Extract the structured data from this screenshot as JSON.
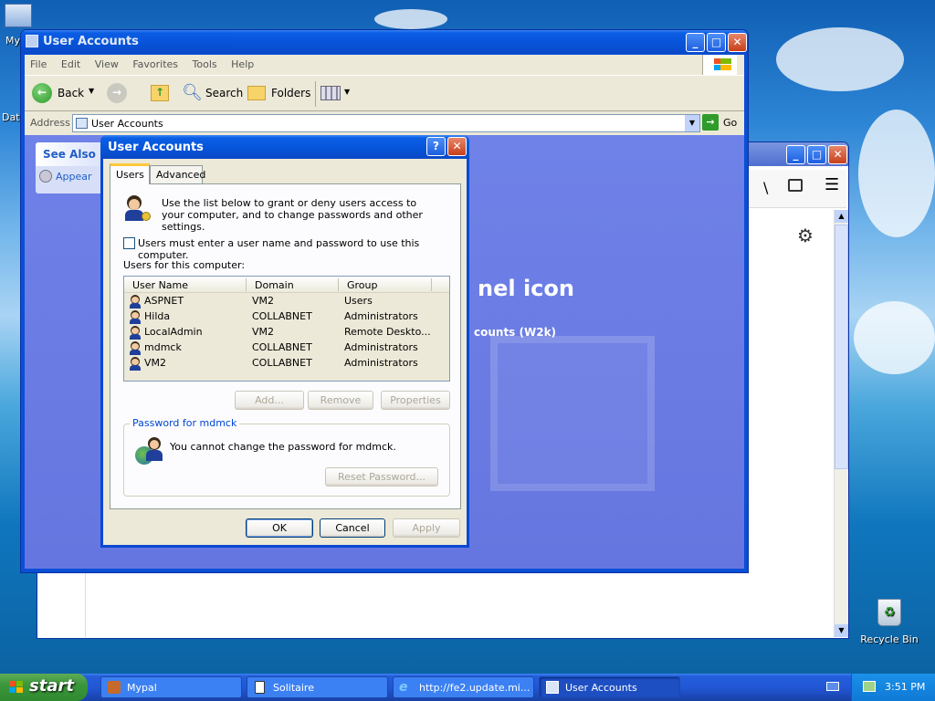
{
  "desktop": {
    "icons": [
      {
        "label": "My"
      },
      {
        "label": "Dat"
      },
      {
        "label": "Recycle Bin"
      }
    ]
  },
  "explorer": {
    "title": "User Accounts",
    "menu": [
      "File",
      "Edit",
      "View",
      "Favorites",
      "Tools",
      "Help"
    ],
    "toolbar": {
      "back": "Back",
      "search": "Search",
      "folders": "Folders"
    },
    "address_label": "Address",
    "address_value": "User Accounts",
    "go": "Go",
    "see_also": {
      "title": "See Also",
      "item": "Appear"
    },
    "bg_text_1": "nel icon",
    "bg_text_2": "counts (W2k)"
  },
  "dialog": {
    "title": "User Accounts",
    "help_btn": "?",
    "close_btn": "✕",
    "tabs": [
      "Users",
      "Advanced"
    ],
    "intro": "Use the list below to grant or deny users access to your computer, and to change passwords and other settings.",
    "checkbox_label": "Users must enter a user name and password to use this computer.",
    "checkbox_checked": false,
    "list_label": "Users for this computer:",
    "columns": [
      "User Name",
      "Domain",
      "Group"
    ],
    "users": [
      {
        "name": "ASPNET",
        "domain": "VM2",
        "group": "Users"
      },
      {
        "name": "Hilda",
        "domain": "COLLABNET",
        "group": "Administrators"
      },
      {
        "name": "LocalAdmin",
        "domain": "VM2",
        "group": "Remote Deskto..."
      },
      {
        "name": "mdmck",
        "domain": "COLLABNET",
        "group": "Administrators"
      },
      {
        "name": "VM2",
        "domain": "COLLABNET",
        "group": "Administrators"
      }
    ],
    "buttons": {
      "add": "Add...",
      "remove": "Remove",
      "properties": "Properties"
    },
    "password_group": "Password for mdmck",
    "password_text": "You cannot change the password for mdmck.",
    "reset_password": "Reset Password...",
    "ok": "OK",
    "cancel": "Cancel",
    "apply": "Apply"
  },
  "taskbar": {
    "start": "start",
    "tasks": [
      {
        "label": "Mypal"
      },
      {
        "label": "Solitaire"
      },
      {
        "label": "http://fe2.update.mi..."
      },
      {
        "label": "User Accounts"
      }
    ],
    "clock": "3:51 PM"
  }
}
